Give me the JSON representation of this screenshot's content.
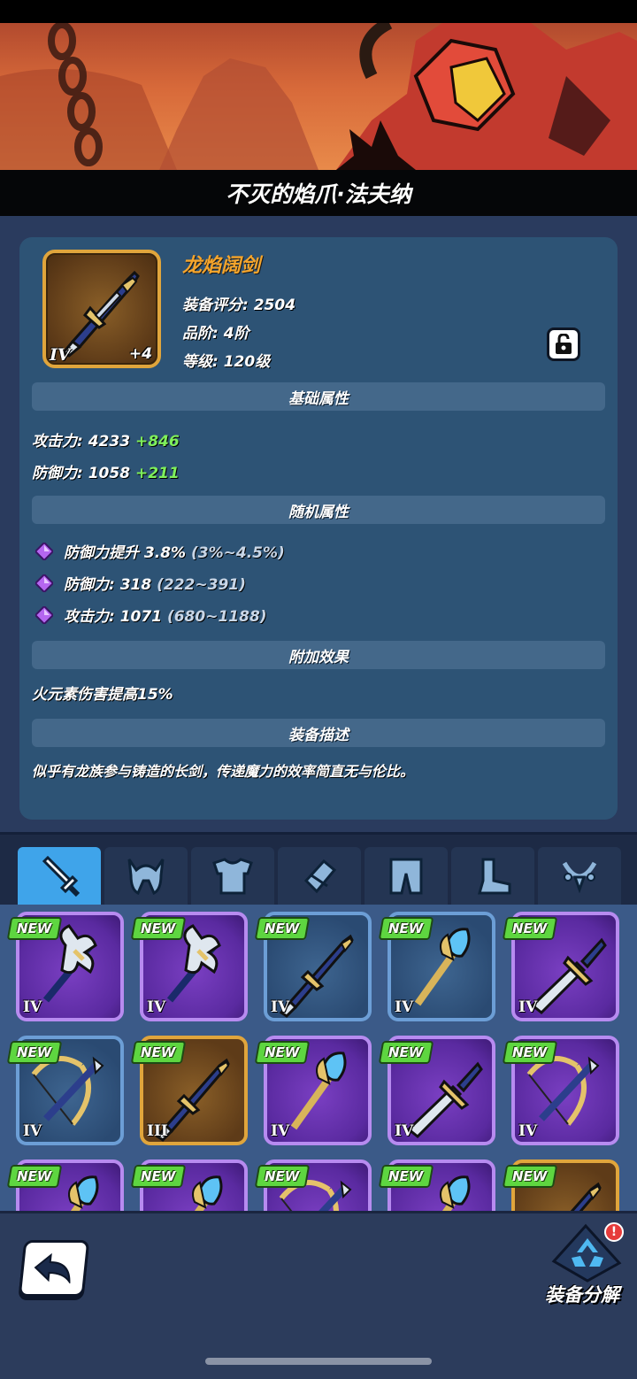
{
  "header": {
    "boss_name": "不灭的焰爪·法夫纳"
  },
  "item": {
    "name": "龙焰阔剑",
    "tier": "IV",
    "enhance": "+4",
    "score": "装备评分: 2504",
    "grade": "品阶: 4阶",
    "level": "等级: 120级",
    "lock_icon": "unlock-icon",
    "rarity_color": "#e0a53c"
  },
  "sections": {
    "base": "基础属性",
    "random": "随机属性",
    "extra": "附加效果",
    "desc": "装备描述"
  },
  "base_stats": [
    {
      "label": "攻击力: 4233",
      "bonus": "+846"
    },
    {
      "label": "防御力: 1058",
      "bonus": "+211"
    }
  ],
  "random_stats": [
    {
      "label": "防御力提升 3.8%",
      "range": "(3%~4.5%)"
    },
    {
      "label": "防御力: 318",
      "range": "(222~391)"
    },
    {
      "label": "攻击力: 1071",
      "range": "(680~1188)"
    }
  ],
  "extra_effect": "火元素伤害提高15%",
  "description": "似乎有龙族参与铸造的长剑，传递魔力的效率简直无与伦比。",
  "tabs": [
    {
      "icon": "sword-icon",
      "active": true
    },
    {
      "icon": "helmet-icon"
    },
    {
      "icon": "armor-icon"
    },
    {
      "icon": "gauntlet-icon"
    },
    {
      "icon": "pants-icon"
    },
    {
      "icon": "boots-icon"
    },
    {
      "icon": "necklace-icon"
    }
  ],
  "inventory": {
    "new_label": "NEW",
    "rows": [
      [
        {
          "tier": "IV",
          "rarity": "purple",
          "icon": "axe-icon"
        },
        {
          "tier": "IV",
          "rarity": "purple",
          "icon": "axe-icon"
        },
        {
          "tier": "IV",
          "rarity": "blue",
          "icon": "sword-icon"
        },
        {
          "tier": "IV",
          "rarity": "blue",
          "icon": "staff-icon"
        },
        {
          "tier": "IV",
          "rarity": "purple",
          "icon": "dagger-icon"
        }
      ],
      [
        {
          "tier": "IV",
          "rarity": "blue",
          "icon": "crossbow-icon"
        },
        {
          "tier": "III",
          "rarity": "gold",
          "icon": "sword-icon"
        },
        {
          "tier": "IV",
          "rarity": "purple",
          "icon": "staff-icon"
        },
        {
          "tier": "IV",
          "rarity": "purple",
          "icon": "dagger-icon"
        },
        {
          "tier": "IV",
          "rarity": "purple",
          "icon": "crossbow-icon"
        }
      ],
      [
        {
          "tier": "",
          "rarity": "purple",
          "icon": "staff-icon"
        },
        {
          "tier": "",
          "rarity": "purple",
          "icon": "staff-icon"
        },
        {
          "tier": "",
          "rarity": "purple",
          "icon": "crossbow-icon"
        },
        {
          "tier": "",
          "rarity": "purple",
          "icon": "staff-icon"
        },
        {
          "tier": "",
          "rarity": "gold",
          "icon": "sword-icon"
        }
      ]
    ]
  },
  "bottom": {
    "back_icon": "back-arrow-icon",
    "disassemble_label": "装备分解",
    "disassemble_badge": "!"
  }
}
